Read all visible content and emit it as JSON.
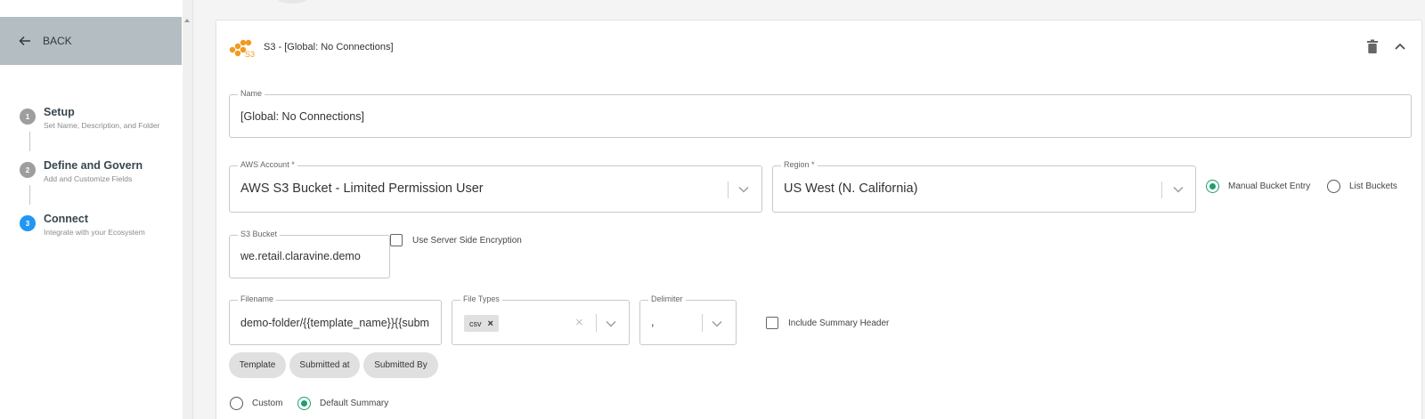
{
  "sidebar": {
    "back_label": "BACK",
    "steps": [
      {
        "number": "1",
        "title": "Setup",
        "subtitle": "Set Name, Description, and Folder",
        "state": "complete"
      },
      {
        "number": "2",
        "title": "Define and Govern",
        "subtitle": "Add and Customize Fields",
        "state": "complete"
      },
      {
        "number": "3",
        "title": "Connect",
        "subtitle": "Integrate with your Ecosystem",
        "state": "active"
      }
    ]
  },
  "card": {
    "title": "S3 - [Global: No Connections]",
    "name_field": {
      "label": "Name",
      "value": "[Global: No Connections]"
    },
    "aws_account": {
      "label": "AWS Account *",
      "value": "AWS S3 Bucket - Limited Permission User"
    },
    "region": {
      "label": "Region *",
      "value": "US West (N. California)"
    },
    "bucket_mode": {
      "manual_label": "Manual Bucket Entry",
      "list_label": "List Buckets",
      "selected": "manual"
    },
    "s3_bucket": {
      "label": "S3 Bucket",
      "value": "we.retail.claravine.demo"
    },
    "encryption_label": "Use Server Side Encryption",
    "filename": {
      "label": "Filename",
      "value": "demo-folder/{{template_name}}{{subm"
    },
    "file_types": {
      "label": "File Types",
      "selected_tag": "csv",
      "remove_symbol": "×",
      "clear_symbol": "×"
    },
    "delimiter": {
      "label": "Delimiter",
      "value": ","
    },
    "summary_header_label": "Include Summary Header",
    "chips": [
      "Template",
      "Submitted at",
      "Submitted By"
    ],
    "summary_mode": {
      "custom_label": "Custom",
      "default_label": "Default Summary",
      "selected": "default"
    }
  },
  "colors": {
    "accent_green": "#1f9e6a",
    "active_step": "#2196f3",
    "back_bar": "#b4bec2"
  }
}
